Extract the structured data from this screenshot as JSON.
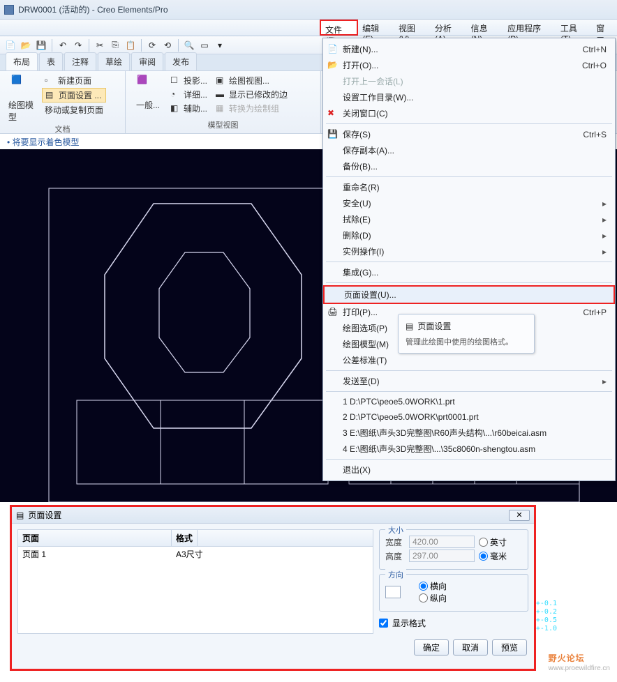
{
  "window": {
    "title": "DRW0001 (活动的) - Creo Elements/Pro"
  },
  "menubar": {
    "items": [
      "文件(F)",
      "编辑(E)",
      "视图(V)",
      "分析(A)",
      "信息(N)",
      "应用程序(P)",
      "工具(T)",
      "窗口"
    ],
    "active": 0
  },
  "tabs": {
    "items": [
      "布局",
      "表",
      "注释",
      "草绘",
      "审阅",
      "发布"
    ],
    "active": 0
  },
  "ribbon": {
    "group1": {
      "model": "绘图模型",
      "newpage": "新建页面",
      "pagesetup": "页面设置 ...",
      "movecopy": "移动或复制页面",
      "label": "文档"
    },
    "group2": {
      "general": "一般...",
      "proj": "投影...",
      "detail": "详细...",
      "aux": "辅助...",
      "dview": "绘图视图...",
      "showmod": "显示已修改的边",
      "togrp": "转换为绘制组",
      "label": "模型视图"
    }
  },
  "status": "将要显示着色模型",
  "dropdown": {
    "new": "新建(N)...",
    "new_sc": "Ctrl+N",
    "open": "打开(O)...",
    "open_sc": "Ctrl+O",
    "openlast": "打开上一会话(L)",
    "setwd": "设置工作目录(W)...",
    "closewin": "关闭窗口(C)",
    "save": "保存(S)",
    "save_sc": "Ctrl+S",
    "savecopy": "保存副本(A)...",
    "backup": "备份(B)...",
    "rename": "重命名(R)",
    "security": "安全(U)",
    "erase": "拭除(E)",
    "delete": "删除(D)",
    "instance": "实例操作(I)",
    "integrate": "集成(G)...",
    "pagesetup": "页面设置(U)...",
    "print": "打印(P)...",
    "print_sc": "Ctrl+P",
    "drawopt": "绘图选项(P)",
    "drawmodel": "绘图模型(M)",
    "tolstd": "公差标准(T)",
    "sendto": "发送至(D)",
    "recent1": "1 D:\\PTC\\peoe5.0WORK\\1.prt",
    "recent2": "2 D:\\PTC\\peoe5.0WORK\\prt0001.prt",
    "recent3": "3 E:\\图纸\\声头3D完整图\\R60声头结构\\...\\r60beicai.asm",
    "recent4": "4 E:\\图纸\\声头3D完整图\\...\\35c8060n-shengtou.asm",
    "exit": "退出(X)"
  },
  "tooltip": {
    "title": "页面设置",
    "body": "管理此绘图中使用的绘图格式。"
  },
  "dialog": {
    "title": "页面设置",
    "cols": {
      "page": "页面",
      "format": "格式"
    },
    "row": {
      "page": "页面 1",
      "format": "A3尺寸"
    },
    "size": {
      "legend": "大小",
      "width": "宽度",
      "height": "高度",
      "wval": "420.00",
      "hval": "297.00",
      "inch": "英寸",
      "mm": "毫米"
    },
    "orient": {
      "legend": "方向",
      "landscape": "横向",
      "portrait": "纵向"
    },
    "showfmt": "显示格式",
    "ok": "确定",
    "cancel": "取消",
    "preview": "预览"
  },
  "coord": "+-0.1\n+-0.2\n+-0.5\n+-1.0",
  "watermark": {
    "main": "野火论坛",
    "sub": "www.proewildfire.cn"
  }
}
